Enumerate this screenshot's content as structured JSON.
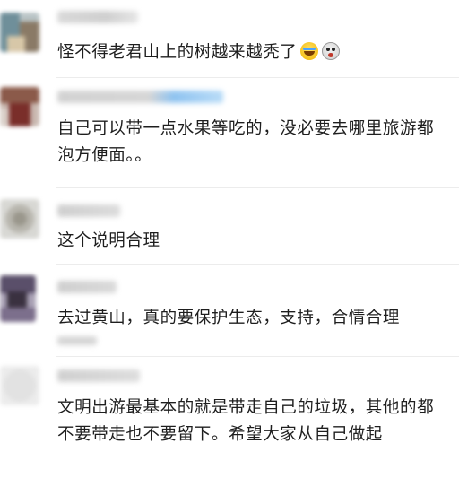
{
  "comments": [
    {
      "text": "怪不得老君山上的树越来越秃了",
      "emojis": [
        "laughing-crying-emoji",
        "crying-face-emoji"
      ]
    },
    {
      "text": "自己可以带一点水果等吃的，没必要去哪里旅游都泡方便面。。"
    },
    {
      "text": "这个说明合理"
    },
    {
      "text": "去过黄山，真的要保护生态，支持，合情合理"
    },
    {
      "text": "文明出游最基本的就是带走自己的垃圾，其他的都不要带走也不要留下。希望大家从自己做起"
    }
  ]
}
